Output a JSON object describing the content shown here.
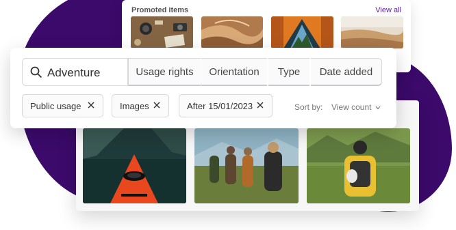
{
  "promoted": {
    "title": "Promoted items",
    "view_all": "View all"
  },
  "search": {
    "query": "Adventure"
  },
  "filter_tabs": [
    "Usage rights",
    "Orientation",
    "Type",
    "Date added"
  ],
  "chips": [
    "Public usage",
    "Images",
    "After 15/01/2023"
  ],
  "sort": {
    "label": "Sort by:",
    "value": "View count"
  },
  "colors": {
    "brand_purple": "#3b0a6b",
    "link_purple": "#5a1a9c"
  },
  "icons": {
    "search": "search-icon",
    "close": "close-icon",
    "chevron": "chevron-down-icon"
  }
}
